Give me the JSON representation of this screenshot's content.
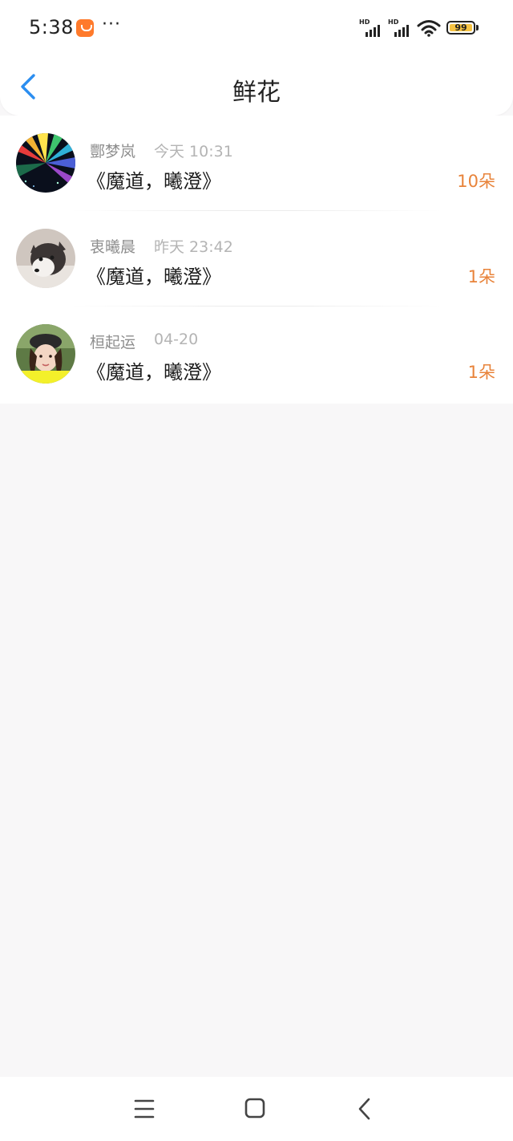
{
  "status_bar": {
    "time": "5:38",
    "more": "···",
    "battery_level": "99",
    "network_label_1": "HD",
    "network_label_2": "HD"
  },
  "nav": {
    "title": "鲜花"
  },
  "items": [
    {
      "name": "酆梦岚",
      "time": "今天 10:31",
      "title": "《魔道，曦澄》",
      "count": "10朵",
      "avatar": "rainbow-avatar"
    },
    {
      "name": "衷曦晨",
      "time": "昨天 23:42",
      "title": "《魔道，曦澄》",
      "count": "1朵",
      "avatar": "husky-avatar"
    },
    {
      "name": "桓起运",
      "time": "04-20",
      "title": "《魔道，曦澄》",
      "count": "1朵",
      "avatar": "girl-avatar"
    }
  ],
  "colors": {
    "accent_count": "#e8833a",
    "back_arrow": "#2b8ef0",
    "background": "#f8f7f8"
  },
  "system_nav": {
    "menu_icon": "menu-icon",
    "home_icon": "home-icon",
    "back_icon": "back-icon"
  }
}
